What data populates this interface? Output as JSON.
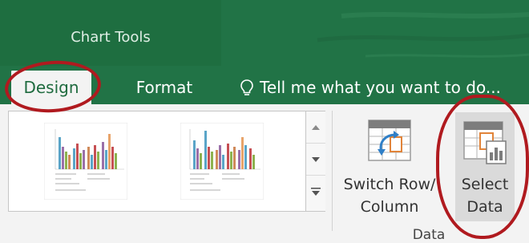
{
  "contextual_tab_group": {
    "label": "Chart Tools"
  },
  "tabs": [
    {
      "label": "Design",
      "selected": true
    },
    {
      "label": "Format",
      "selected": false
    }
  ],
  "tell_me": {
    "icon": "lightbulb-icon",
    "text": "Tell me what you want to do..."
  },
  "chart_styles_gallery": {
    "scroll_up_icon": "scroll-up-icon",
    "scroll_down_icon": "scroll-down-icon",
    "more_icon": "gallery-more-icon"
  },
  "data_group": {
    "label": "Data",
    "switch_row_column": {
      "label": "Switch Row/\nColumn",
      "icon": "switch-row-column-icon"
    },
    "select_data": {
      "label": "Select\nData",
      "icon": "select-data-icon"
    }
  },
  "colors": {
    "ribbon_green": "#217346",
    "annotation_red": "#b01a1f"
  }
}
